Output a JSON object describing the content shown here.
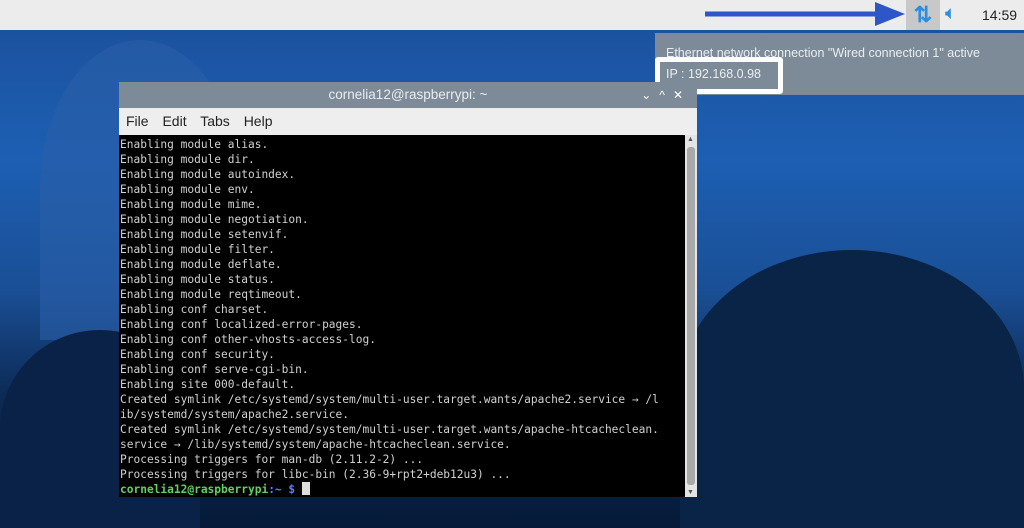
{
  "taskbar": {
    "clock": "14:59",
    "network_icon": "network-updown-icon",
    "volume_icon": "speaker-icon",
    "accent": "#2a8ee0"
  },
  "notification": {
    "line1": "Ethernet network connection \"Wired connection 1\" active",
    "line2": "IP : 192.168.0.98"
  },
  "window": {
    "title": "cornelia12@raspberrypi: ~",
    "menu": [
      "File",
      "Edit",
      "Tabs",
      "Help"
    ]
  },
  "terminal": {
    "lines": [
      "Enabling module alias.",
      "Enabling module dir.",
      "Enabling module autoindex.",
      "Enabling module env.",
      "Enabling module mime.",
      "Enabling module negotiation.",
      "Enabling module setenvif.",
      "Enabling module filter.",
      "Enabling module deflate.",
      "Enabling module status.",
      "Enabling module reqtimeout.",
      "Enabling conf charset.",
      "Enabling conf localized-error-pages.",
      "Enabling conf other-vhosts-access-log.",
      "Enabling conf security.",
      "Enabling conf serve-cgi-bin.",
      "Enabling site 000-default.",
      "Created symlink /etc/systemd/system/multi-user.target.wants/apache2.service → /l",
      "ib/systemd/system/apache2.service.",
      "Created symlink /etc/systemd/system/multi-user.target.wants/apache-htcacheclean.",
      "service → /lib/systemd/system/apache-htcacheclean.service.",
      "Processing triggers for man-db (2.11.2-2) ...",
      "Processing triggers for libc-bin (2.36-9+rpt2+deb12u3) ..."
    ],
    "prompt_user": "cornelia12@raspberrypi",
    "prompt_path": ":~",
    "prompt_symbol": "$"
  }
}
